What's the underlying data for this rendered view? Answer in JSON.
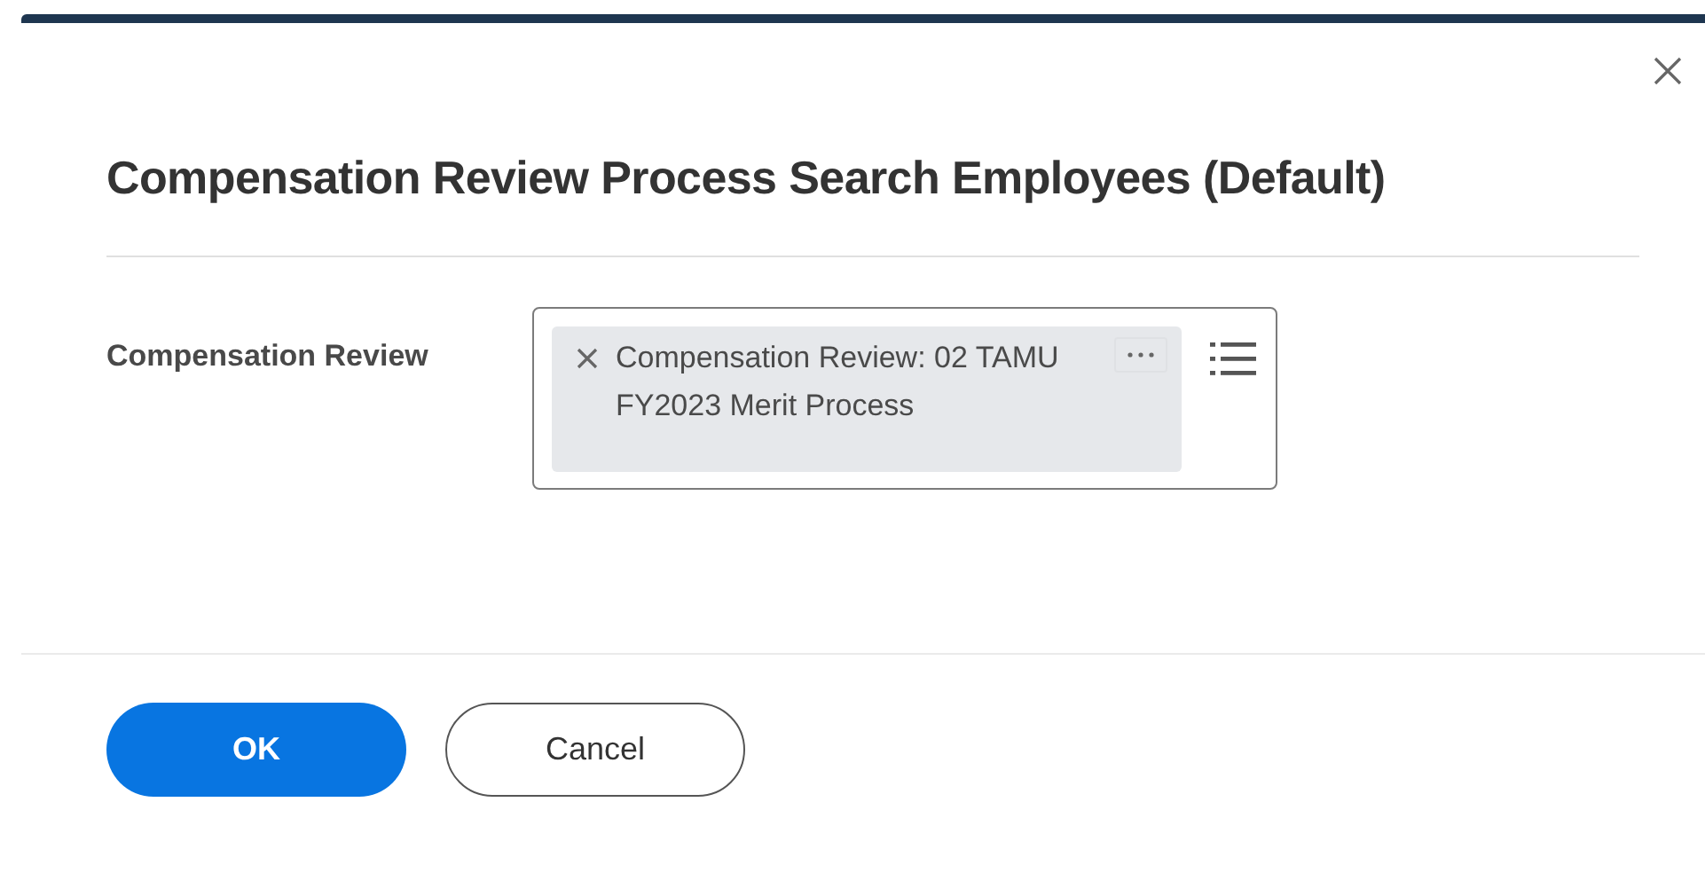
{
  "dialog": {
    "title": "Compensation Review Process Search Employees (Default)"
  },
  "fields": [
    {
      "label": "Compensation Review",
      "chips": [
        {
          "text": "Compensation Review: 02 TAMU FY2023 Merit Process"
        }
      ]
    }
  ],
  "buttons": [
    {
      "label": "OK",
      "kind": "primary"
    },
    {
      "label": "Cancel",
      "kind": "secondary"
    }
  ]
}
